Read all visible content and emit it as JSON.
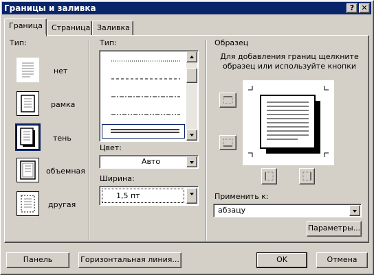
{
  "window": {
    "title": "Границы и заливка",
    "help_btn": "?",
    "close_btn": "✕"
  },
  "tabs": [
    {
      "label": "Граница",
      "active": true
    },
    {
      "label": "Страница",
      "active": false
    },
    {
      "label": "Заливка",
      "active": false
    }
  ],
  "type_section": {
    "label": "Тип:",
    "options": [
      {
        "label": "нет",
        "icon": "no-border-icon",
        "selected": false
      },
      {
        "label": "рамка",
        "icon": "box-border-icon",
        "selected": false
      },
      {
        "label": "тень",
        "icon": "shadow-border-icon",
        "selected": true
      },
      {
        "label": "объемная",
        "icon": "3d-border-icon",
        "selected": false
      },
      {
        "label": "другая",
        "icon": "custom-border-icon",
        "selected": false
      }
    ]
  },
  "style_section": {
    "label": "Тип:",
    "styles": [
      "dotted",
      "dashed",
      "dash-dot",
      "dash-dot-dot",
      "double"
    ],
    "selected_index": 4,
    "color_label": "Цвет:",
    "color_value": "Авто",
    "width_label": "Ширина:",
    "width_value": "1,5 пт"
  },
  "preview": {
    "label": "Образец",
    "hint": "Для добавления границ щелкните образец или используйте кнопки",
    "apply_label": "Применить к:",
    "apply_value": "абзацу",
    "params_button": "Параметры..."
  },
  "footer": {
    "panel_button": "Панель",
    "hline_button": "Горизонтальная линия...",
    "ok_button": "OK",
    "cancel_button": "Отмена"
  },
  "colors": {
    "titlebar": "#0a246a",
    "face": "#d4d0c8",
    "selection": "#0a246a"
  }
}
